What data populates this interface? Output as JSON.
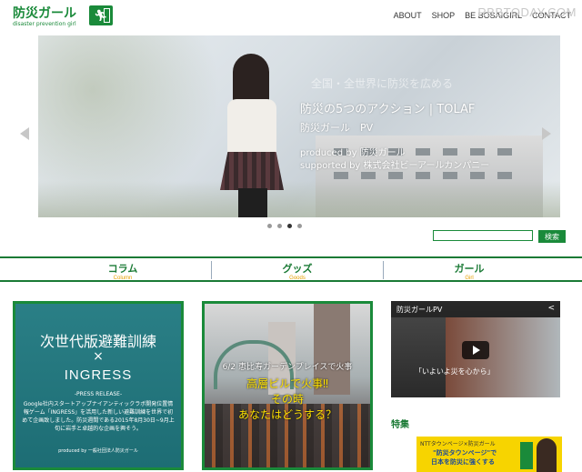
{
  "logo": {
    "title": "防災ガール",
    "subtitle": "disaster prevention girl"
  },
  "nav": {
    "items": [
      "ABOUT",
      "SHOP",
      "BE BOSAIGIRL",
      "CONTACT"
    ]
  },
  "watermark": "RBBTODAY.COM",
  "slider": {
    "ghost_text": "全国・全世界に防災を広める",
    "title": "防災の5つのアクション | TOLAF",
    "subtitle": "防災ガール　PV",
    "credit_line1": "produced by 防災ガール",
    "credit_line2": "supported by 株式会社ビーアールカンパニー",
    "dots": 4,
    "active_dot": 3
  },
  "search": {
    "button_label": "検索",
    "value": ""
  },
  "categories": [
    {
      "jp": "コラム",
      "en": "Column"
    },
    {
      "jp": "グッズ",
      "en": "Goods"
    },
    {
      "jp": "ガール",
      "en": "Girl"
    }
  ],
  "card1": {
    "line1": "次世代版避難訓練",
    "line2": "×",
    "line3": "INGRESS",
    "press": "-PRESS RELEASE-",
    "body": "Google社内スタートアップナイアンティックラボ開発位置情報ゲーム「INGRESS」を活用した新しい避難訓練を世界で初めて企画致しました。防災週間である2015年8月30日~9月上旬に岩手と卓越的な企画を興そう。",
    "produced": "produced by 一般社団法人防災ガール"
  },
  "card2": {
    "line1": "6/2 恵比寿ガーデンプレイスで火事",
    "line2": "高層ビルで火事‼",
    "line3": "その時",
    "line4": "あなたはどうする？"
  },
  "video": {
    "title": "防災ガールPV",
    "caption": "「いよいよ災を心から」"
  },
  "tokushu": "特集",
  "banner": {
    "line1": "NTTタウンページ×防災ガール",
    "line2": "\"防災タウンページ\"で",
    "line3": "日本を防災に強くする"
  }
}
